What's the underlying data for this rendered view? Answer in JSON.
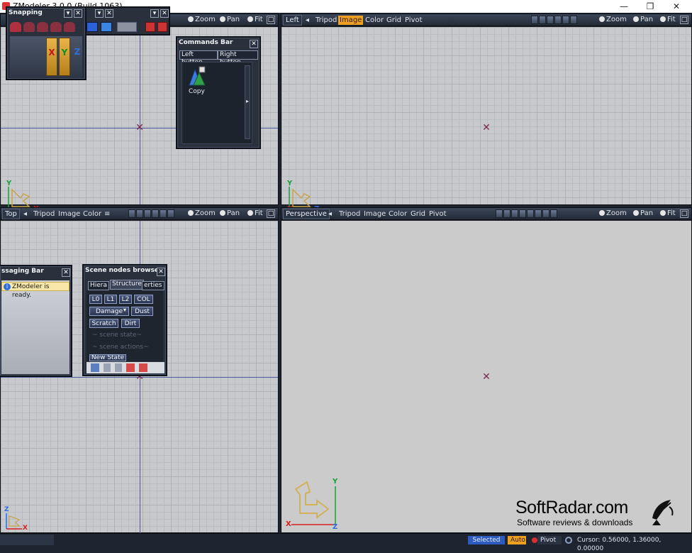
{
  "window": {
    "title": "ZModeler 3.0.0 (Build 1063)",
    "min": "—",
    "restore": "❐",
    "close": "✕"
  },
  "viewports": {
    "topleft": {
      "items": [
        "Zoom",
        "Pan",
        "Fit"
      ]
    },
    "left": {
      "name": "Left",
      "items": [
        "Tripod",
        "Image",
        "Color",
        "Grid",
        "Pivot"
      ],
      "selected": "Image",
      "tools": [
        "Zoom",
        "Pan",
        "Fit"
      ],
      "axes": {
        "up": "Y",
        "right": "Z",
        "origin": "X"
      }
    },
    "top": {
      "name": "Top",
      "items": [
        "Tripod",
        "Image",
        "Color"
      ],
      "tools": [
        "Zoom",
        "Pan",
        "Fit"
      ],
      "axes": {
        "up": "Z",
        "right": "X"
      }
    },
    "front_axes": {
      "up": "Y",
      "right": "X"
    },
    "perspective": {
      "name": "Perspective",
      "items": [
        "Tripod",
        "Image",
        "Color",
        "Grid",
        "Pivot"
      ],
      "tools": [
        "Zoom",
        "Pan",
        "Fit"
      ],
      "axes": {
        "up": "Y",
        "right": "Z",
        "origin": "X"
      }
    }
  },
  "snapping": {
    "title": "Snapping",
    "axes": [
      "X",
      "Y",
      "Z"
    ]
  },
  "commands_bar": {
    "title": "Commands Bar",
    "left": "Left button",
    "right": "Right button",
    "command": "Copy"
  },
  "messaging_bar": {
    "title": "ssaging Bar",
    "message": "ZModeler is ready."
  },
  "scene_nodes": {
    "title": "Scene nodes browser",
    "tabs": [
      "Hiera",
      "Structure",
      "erties"
    ],
    "row1": [
      "L0",
      "L1",
      "L2",
      "COL"
    ],
    "row2": [
      "Damage",
      "Dust"
    ],
    "row3": [
      "Scratch",
      "Dirt"
    ],
    "dim1": "~ scene state~",
    "dim2": "~ scene actions~",
    "new_state": "New State"
  },
  "statusbar": {
    "selected": "Selected",
    "auto": "Auto",
    "pivot": "Pivot",
    "cursor": "Cursor: 0.56000, 1.36000, 0.00000"
  },
  "watermark": {
    "title": "SoftRadar.com",
    "subtitle": "Software reviews & downloads"
  },
  "colors": {
    "accent": "#f0a020",
    "axis_red": "#d81e1e",
    "axis_green": "#17a23a",
    "axis_blue": "#2d6fe0"
  }
}
